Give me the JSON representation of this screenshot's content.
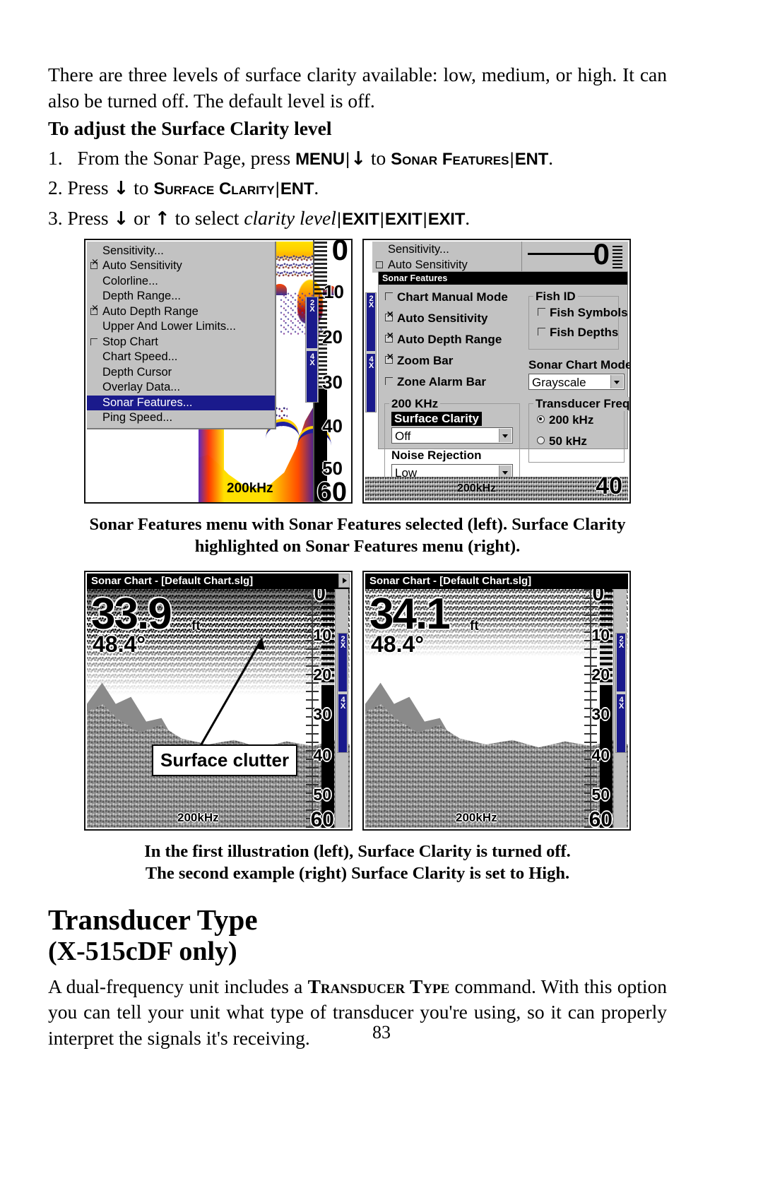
{
  "page": {
    "number": "83"
  },
  "intro": {
    "paragraph": "There are three levels of surface clarity available: low, medium, or high. It can also be turned off. The default level is off."
  },
  "procedure": {
    "heading": "To adjust the Surface Clarity level",
    "steps": [
      {
        "num": "1.",
        "pre": "From the Sonar Page, press ",
        "key1": "MENU",
        "sep1": "|",
        "mid1": " to ",
        "arrow1": "↓",
        "smallcaps1": "Sonar Features",
        "sep2": "|",
        "key2": "ENT",
        "tail": "."
      },
      {
        "num": "2.",
        "pre": "Press ",
        "arrow1": "↓",
        "mid1": " to ",
        "smallcaps1": "Surface Clarity",
        "sep2": "|",
        "key2": "ENT",
        "tail": "."
      },
      {
        "num": "3.",
        "pre": "Press ",
        "arrow1": "↓",
        "mid_or": " or ",
        "arrow2": "↑",
        "mid1": " to select ",
        "italic": "clarity level",
        "sep2": "|",
        "key2": "EXIT",
        "sep3": "|",
        "key3": "EXIT",
        "sep4": "|",
        "key4": "EXIT",
        "tail": "."
      }
    ]
  },
  "figure1": {
    "caption": "Sonar Features menu with Sonar Features selected (left). Surface Clarity highlighted on Sonar Features menu (right).",
    "left": {
      "menu_items": [
        {
          "label": "Sensitivity...",
          "checkbox": "none",
          "selected": false
        },
        {
          "label": "Auto Sensitivity",
          "checkbox": "checked",
          "selected": false
        },
        {
          "label": "Colorline...",
          "checkbox": "none",
          "selected": false
        },
        {
          "label": "Depth Range...",
          "checkbox": "none",
          "selected": false
        },
        {
          "label": "Auto Depth Range",
          "checkbox": "checked",
          "selected": false
        },
        {
          "label": "Upper And Lower Limits...",
          "checkbox": "none",
          "selected": false
        },
        {
          "label": "Stop Chart",
          "checkbox": "unchecked",
          "selected": false
        },
        {
          "label": "Chart Speed...",
          "checkbox": "none",
          "selected": false
        },
        {
          "label": "Depth Cursor",
          "checkbox": "none",
          "selected": false
        },
        {
          "label": "Overlay Data...",
          "checkbox": "none",
          "selected": false
        },
        {
          "label": "Sonar Features...",
          "checkbox": "none",
          "selected": true
        },
        {
          "label": "Ping Speed...",
          "checkbox": "none",
          "selected": false
        }
      ],
      "depth_labels": [
        "0",
        "10",
        "20",
        "30",
        "40",
        "50",
        "60"
      ],
      "zoom_bar": [
        "2X",
        "4X"
      ],
      "frequency": "200kHz"
    },
    "right": {
      "top_menu": [
        "Sensitivity...",
        "Auto Sensitivity"
      ],
      "top_digit": "0",
      "dialog_title": "Sonar Features",
      "checkboxes": [
        {
          "label": "Chart Manual Mode",
          "state": "unchecked"
        },
        {
          "label": "Auto Sensitivity",
          "state": "checked"
        },
        {
          "label": "Auto Depth Range",
          "state": "checked"
        },
        {
          "label": "Zoom Bar",
          "state": "checked"
        },
        {
          "label": "Zone Alarm Bar",
          "state": "unchecked"
        }
      ],
      "group_200khz": {
        "legend": "200 KHz",
        "surface_clarity_label": "Surface Clarity",
        "surface_clarity_value": "Off",
        "noise_rejection_label": "Noise Rejection",
        "noise_rejection_value": "Low"
      },
      "group_fish_id": {
        "legend": "Fish ID",
        "items": [
          {
            "label": "Fish Symbols",
            "state": "unchecked"
          },
          {
            "label": "Fish Depths",
            "state": "unchecked"
          }
        ]
      },
      "sonar_chart_mode_label": "Sonar Chart Mode",
      "sonar_chart_mode_value": "Grayscale",
      "transducer_freq": {
        "legend": "Transducer Freq.",
        "options": [
          {
            "label": "200 kHz",
            "selected": true
          },
          {
            "label": "50 kHz",
            "selected": false
          }
        ]
      },
      "zoom_bar": [
        "2X",
        "4X"
      ],
      "frequency": "200kHz",
      "depth_big": "40"
    }
  },
  "figure2": {
    "caption_line1": "In the first illustration (left), Surface Clarity is turned off.",
    "caption_line2": "The second example (right) Surface Clarity is set to High.",
    "left": {
      "title": "Sonar Chart - [Default Chart.slg]",
      "depth": "33.9",
      "depth_unit": "ft",
      "temperature": "48.4°",
      "depth_labels": [
        "0",
        "10",
        "20",
        "30",
        "40",
        "50",
        "60"
      ],
      "zoom_bar": [
        "2X",
        "4X"
      ],
      "frequency": "200kHz",
      "callout": "Surface clutter"
    },
    "right": {
      "title": "Sonar Chart - [Default Chart.slg]",
      "depth": "34.1",
      "depth_unit": "ft",
      "temperature": "48.4°",
      "depth_labels": [
        "0",
        "10",
        "20",
        "30",
        "40",
        "50",
        "60"
      ],
      "zoom_bar": [
        "2X",
        "4X"
      ],
      "frequency": "200kHz"
    }
  },
  "section": {
    "title": "Transducer Type",
    "subtitle": "(X-515cDF only)",
    "body_pre": "A dual-frequency unit includes a ",
    "body_smallcaps": "Transducer Type",
    "body_post": " command. With this option you can tell your unit what type of transducer you're using, so it can properly interpret the signals it's receiving."
  }
}
